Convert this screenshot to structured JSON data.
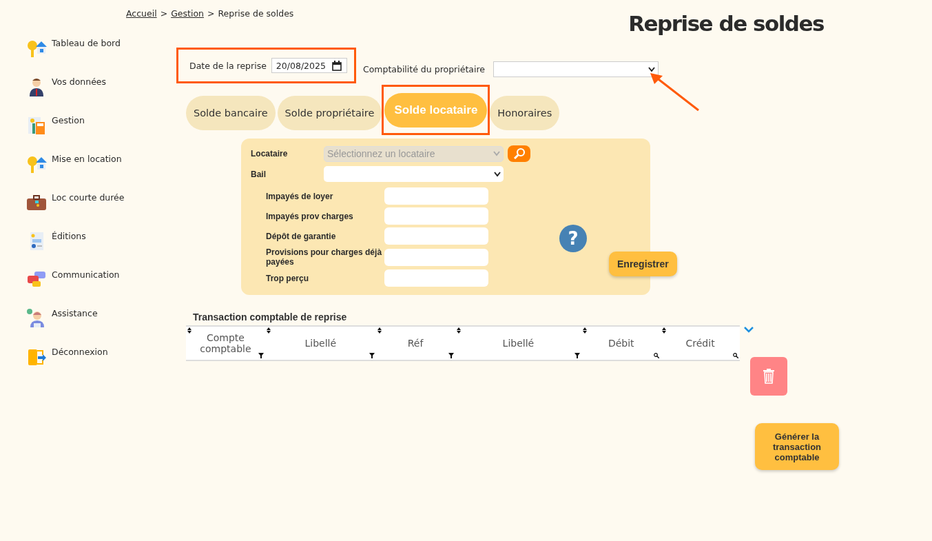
{
  "breadcrumb": [
    {
      "label": "Accueil",
      "link": true
    },
    {
      "label": ">",
      "link": false
    },
    {
      "label": "Gestion",
      "link": true
    },
    {
      "label": ">",
      "link": false
    },
    {
      "label": "Reprise de soldes",
      "link": false
    }
  ],
  "title": "Reprise de soldes",
  "sidebar": {
    "items": [
      {
        "label": "Tableau de bord",
        "kind": "keyhouse"
      },
      {
        "label": "Vos données",
        "kind": "person"
      },
      {
        "label": "Gestion",
        "kind": "calculator"
      },
      {
        "label": "Mise en location",
        "kind": "keyhouse"
      },
      {
        "label": "Loc courte durée",
        "kind": "suitcase"
      },
      {
        "label": "Éditions",
        "kind": "report"
      },
      {
        "label": "Communication",
        "kind": "chat"
      },
      {
        "label": "Assistance",
        "kind": "agent"
      },
      {
        "label": "Déconnexion",
        "kind": "logout"
      }
    ]
  },
  "date": {
    "label": "Date de la reprise",
    "value": "20/08/2025",
    "highlighted": true
  },
  "owner_account": {
    "label": "Comptabilité du propriétaire",
    "pointed": true
  },
  "tabs": [
    {
      "label": "Solde bancaire",
      "selected": false,
      "highlighted": false
    },
    {
      "label": "Solde propriétaire",
      "selected": false,
      "highlighted": false
    },
    {
      "label": "Solde locataire",
      "selected": true,
      "highlighted": true
    },
    {
      "label": "Honoraires",
      "selected": false,
      "highlighted": false
    }
  ],
  "tenant_form": {
    "tenant": {
      "label": "Locataire",
      "placeholder": "Sélectionnez un locataire",
      "disabled": true
    },
    "lease": {
      "label": "Bail"
    },
    "fields": [
      {
        "label": "Impayés de loyer"
      },
      {
        "label": "Impayés prov charges"
      },
      {
        "label": "Dépôt de garantie"
      },
      {
        "label": "Provisions pour charges déjà payées"
      },
      {
        "label": "Trop perçu"
      }
    ],
    "help": "?",
    "save": "Enregistrer"
  },
  "transaction": {
    "title": "Transaction comptable de reprise",
    "columns": [
      {
        "label": "Compte comptable",
        "kind": "funnel"
      },
      {
        "label": "Libellé",
        "kind": "funnel"
      },
      {
        "label": "Réf",
        "kind": "funnel"
      },
      {
        "label": "Libellé",
        "kind": "funnel"
      },
      {
        "label": "Débit",
        "kind": "search"
      },
      {
        "label": "Crédit",
        "kind": "search"
      }
    ]
  },
  "generate": "Générer la transaction comptable"
}
